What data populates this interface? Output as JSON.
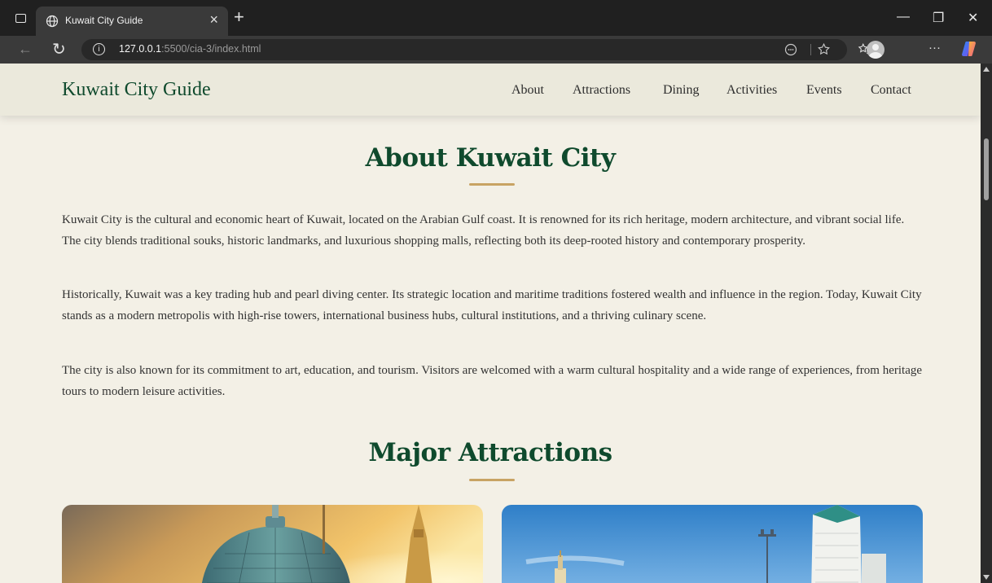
{
  "browser": {
    "tab_title": "Kuwait City Guide",
    "tab_close": "×",
    "new_tab": "+",
    "url_host": "127.0.0.1",
    "url_path": ":5500/cia-3/index.html",
    "minimize": "—",
    "restore": "❐",
    "close": "✕",
    "back": "←",
    "reload": "↻",
    "more": "···"
  },
  "header": {
    "logo": "Kuwait City Guide",
    "nav": [
      "About",
      "Attractions",
      "Dining",
      "Activities",
      "Events",
      "Contact"
    ]
  },
  "about": {
    "title": "About Kuwait City",
    "paragraphs": [
      "Kuwait City is the cultural and economic heart of Kuwait, located on the Arabian Gulf coast. It is renowned for its rich heritage, modern architecture, and vibrant social life. The city blends traditional souks, historic landmarks, and luxurious shopping malls, reflecting both its deep-rooted history and contemporary prosperity.",
      "Historically, Kuwait was a key trading hub and pearl diving center. Its strategic location and maritime traditions fostered wealth and influence in the region. Today, Kuwait City stands as a modern metropolis with high-rise towers, international business hubs, cultural institutions, and a thriving culinary scene.",
      "The city is also known for its commitment to art, education, and tourism. Visitors are welcomed with a warm cultural hospitality and a wide range of experiences, from heritage tours to modern leisure activities."
    ]
  },
  "attractions": {
    "title": "Major Attractions"
  },
  "colors": {
    "brand_green": "#0f4a2d",
    "accent_gold": "#c8a363",
    "page_bg": "#f3f0e6"
  }
}
